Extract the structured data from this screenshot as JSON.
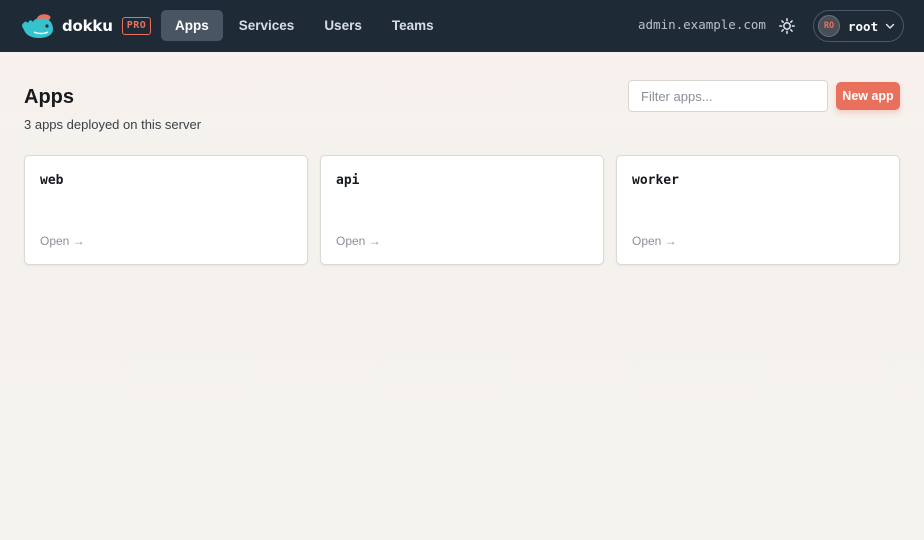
{
  "brand": {
    "name": "dokku",
    "badge": "PRO",
    "logo_icon": "whale-icon",
    "accent": "#e8705c"
  },
  "nav": {
    "items": [
      {
        "label": "Apps",
        "active": true
      },
      {
        "label": "Services",
        "active": false
      },
      {
        "label": "Users",
        "active": false
      },
      {
        "label": "Teams",
        "active": false
      }
    ]
  },
  "header": {
    "host": "admin.example.com",
    "theme_icon": "sun-icon",
    "user": {
      "avatar_initials": "RO",
      "name": "root",
      "menu_icon": "chevron-down-icon"
    }
  },
  "main": {
    "title": "Apps",
    "subtitle": "3 apps deployed on this server",
    "filter_placeholder": "Filter apps...",
    "new_button": "New app",
    "apps": [
      {
        "name": "web",
        "action": "Open →"
      },
      {
        "name": "api",
        "action": "Open →"
      },
      {
        "name": "worker",
        "action": "Open →"
      }
    ]
  },
  "colors": {
    "topbar": "#1f2a37",
    "accent": "#e8705c",
    "background": "#f5f3ef"
  }
}
